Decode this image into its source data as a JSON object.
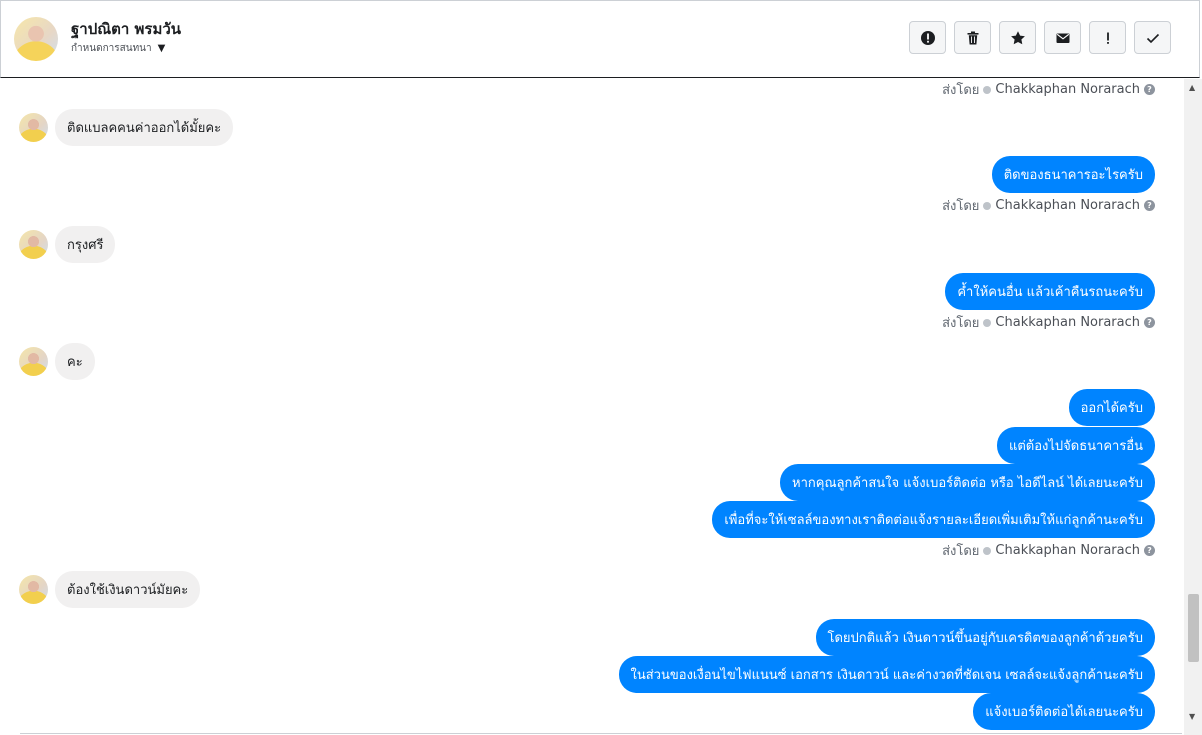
{
  "header": {
    "name": "ฐาปณิตา พรมวัน",
    "subtitle": "กำหนดการสนทนา",
    "actions": [
      {
        "name": "report-icon"
      },
      {
        "name": "trash-icon"
      },
      {
        "name": "star-icon"
      },
      {
        "name": "envelope-icon"
      },
      {
        "name": "exclamation-icon"
      },
      {
        "name": "check-icon"
      }
    ]
  },
  "thread": {
    "sent_by_label": "ส่งโดย",
    "agent_name": "Chakkaphan Norarach",
    "incoming": [
      "ติดแบลคคนค่าออกได้มั้ยคะ",
      "กรุงศรี",
      "คะ",
      "ต้องใช้เงินดาวน์มัยคะ"
    ],
    "outgoing": [
      "ติดของธนาคารอะไรครับ",
      "ค้ำให้คนอื่น แล้วเค้าคืนรถนะครับ",
      "ออกได้ครับ",
      "แต่ต้องไปจัดธนาคารอื่น",
      "หากคุณลูกค้าสนใจ แจ้งเบอร์ติดต่อ หรือ ไอดีไลน์ ได้เลยนะครับ",
      "เพื่อที่จะให้เซลล์ของทางเราติดต่อแจ้งรายละเอียดเพิ่มเติมให้แก่ลูกค้านะครับ",
      "โดยปกติแล้ว เงินดาวน์ขึ้นอยู่กับเครดิตของลูกค้าด้วยครับ",
      "ในส่วนของเงื่อนไขไฟแนนซ์ เอกสาร เงินดาวน์ และค่างวดที่ชัดเจน เซลล์จะแจ้งลูกค้านะครับ",
      "แจ้งเบอร์ติดต่อได้เลยนะครับ"
    ]
  }
}
